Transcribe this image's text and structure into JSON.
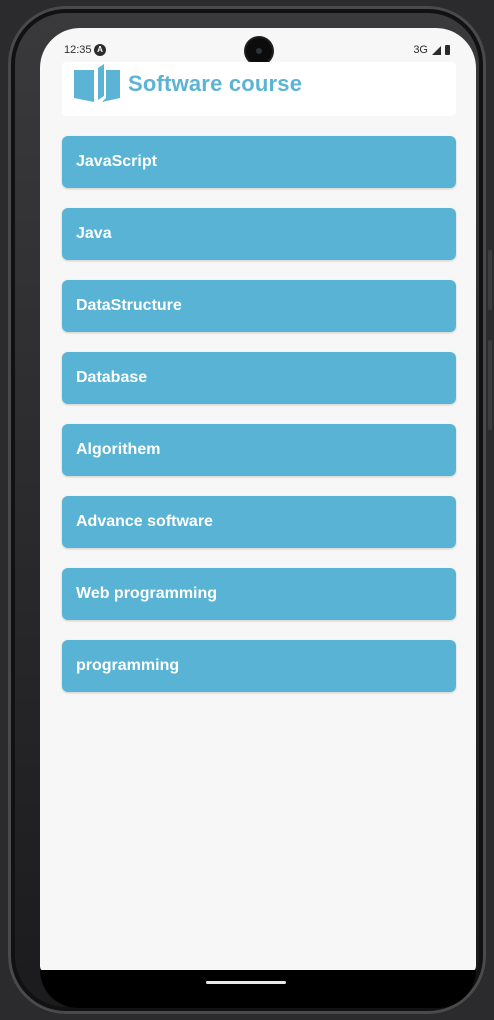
{
  "status_bar": {
    "time": "12:35",
    "network": "3G",
    "icons": [
      "a-icon",
      "signal-icon",
      "battery-icon"
    ]
  },
  "header": {
    "title": "Software course",
    "icon": "book-icon"
  },
  "courses": [
    {
      "label": "JavaScript"
    },
    {
      "label": "Java"
    },
    {
      "label": "DataStructure"
    },
    {
      "label": "Database"
    },
    {
      "label": "Algorithem"
    },
    {
      "label": "Advance software"
    },
    {
      "label": "Web programming"
    },
    {
      "label": "programming"
    }
  ],
  "colors": {
    "accent": "#5bb4d6",
    "button_bg": "#58b3d4",
    "screen_bg": "#f7f7f7",
    "button_text": "#ffffff"
  }
}
